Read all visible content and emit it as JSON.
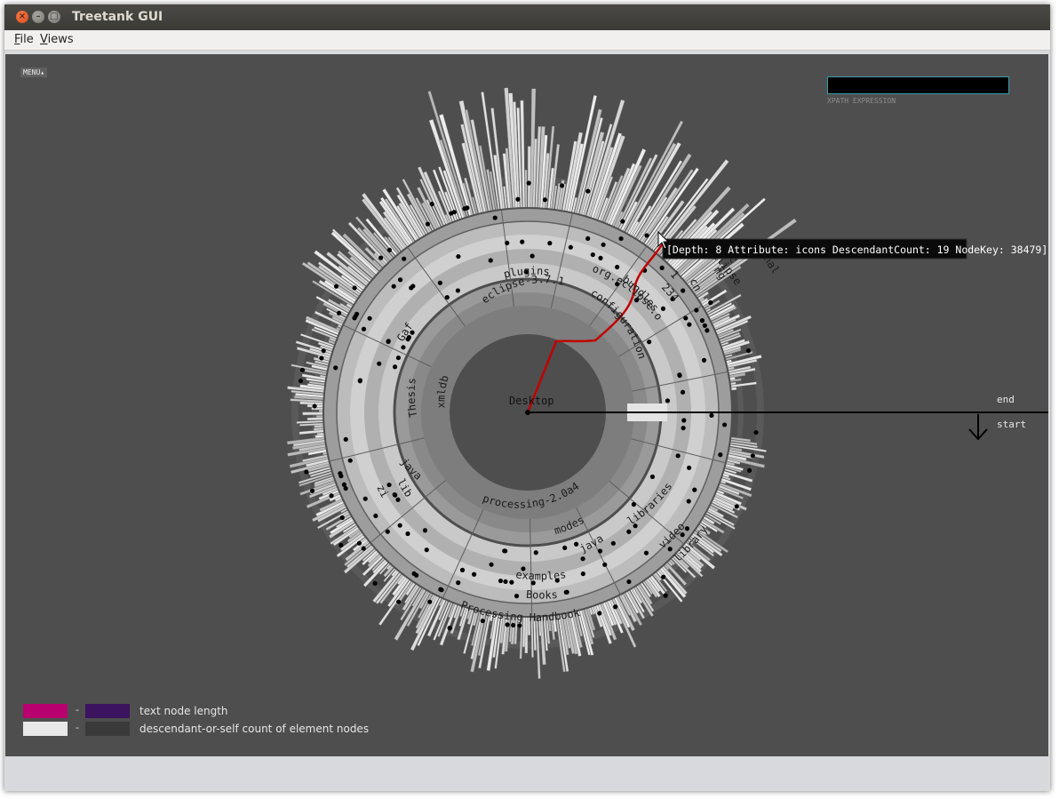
{
  "window": {
    "title": "Treetank GUI"
  },
  "menubar": {
    "file": {
      "accel": "F",
      "rest": "ile"
    },
    "views": {
      "accel": "V",
      "rest": "iews"
    }
  },
  "viz": {
    "menu_toggle": "MENU▴",
    "xpath": {
      "value": "",
      "label": "XPATH EXPRESSION"
    },
    "root_label": "Desktop",
    "tooltip": "[Depth: 8 Attribute: icons DescendantCount: 19 NodeKey: 38479]",
    "compare_end": "end",
    "compare_start": "start",
    "arc_labels": {
      "plugins": "plugins",
      "org_eclipse_osgi": "org.eclipse.osgi",
      "eclipse": "eclipse-3.7.1",
      "configuration": "configuration",
      "bundles": "bundles",
      "n234": "234",
      "n1": "1",
      "cn": "cn",
      "ng": "ng",
      "ic": "ic",
      "nal": "nal",
      "eclipse2": "eclipse",
      "xmldb": "xmldb",
      "thesis": "Thesis",
      "gaf": "Gaf",
      "java": "java",
      "lib": "lib",
      "zi": "zi",
      "processing": "processing-2.0a4",
      "modes": "modes",
      "java2": "java",
      "libraries": "libraries",
      "video": "video",
      "library": "library",
      "examples": "examples",
      "books": "Books",
      "handbook": "Processing Handbook"
    }
  },
  "legend": {
    "text_length": {
      "label": "text node length",
      "color_from": "#b8006e",
      "color_to": "#3b135e"
    },
    "descendant_count": {
      "label": "descendant-or-self count of element nodes",
      "color_from": "#e8e8e8",
      "color_to": "#3a3a3a"
    },
    "separator": "-"
  }
}
